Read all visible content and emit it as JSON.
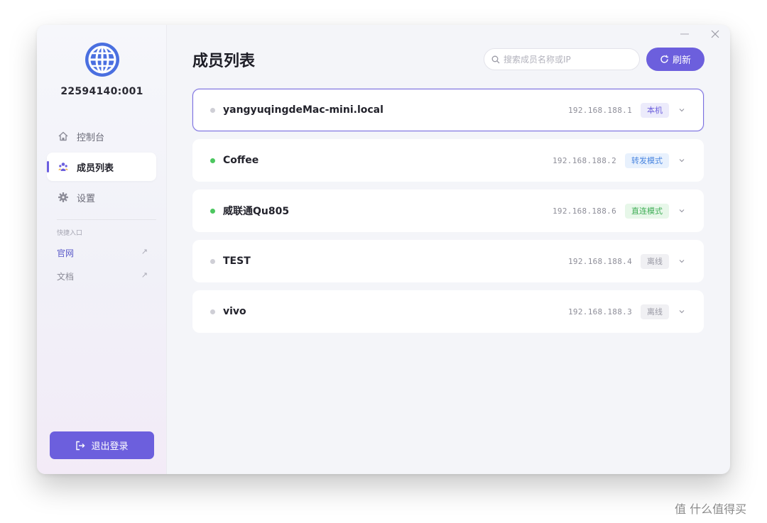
{
  "sidebar": {
    "node_id": "22594140:001",
    "nav": [
      {
        "label": "控制台",
        "icon": "home-icon"
      },
      {
        "label": "成员列表",
        "icon": "users-icon"
      },
      {
        "label": "设置",
        "icon": "gear-icon"
      }
    ],
    "quick_title": "快捷入口",
    "quick_links": [
      {
        "label": "官网",
        "arrow": "↗"
      },
      {
        "label": "文档",
        "arrow": "↗"
      }
    ],
    "logout_label": "退出登录"
  },
  "main": {
    "title": "成员列表",
    "search_placeholder": "搜索成员名称或IP",
    "refresh_label": "刷新",
    "members": [
      {
        "name": "yangyuqingdeMac-mini.local",
        "ip": "192.168.188.1",
        "badge": "本机"
      },
      {
        "name": "Coffee",
        "ip": "192.168.188.2",
        "badge": "转发模式"
      },
      {
        "name": "威联通Qu805",
        "ip": "192.168.188.6",
        "badge": "直连模式"
      },
      {
        "name": "TEST",
        "ip": "192.168.188.4",
        "badge": "离线"
      },
      {
        "name": "vivo",
        "ip": "192.168.188.3",
        "badge": "离线"
      }
    ]
  },
  "colors": {
    "accent": "#6c5fdd",
    "online": "#4cc760",
    "offline": "#cfcfd6",
    "badge_local_bg": "#ecebfb",
    "badge_local_fg": "#6c5fdd",
    "badge_relay_bg": "#e8f1fd",
    "badge_relay_fg": "#4a86e0",
    "badge_direct_bg": "#e7f7e9",
    "badge_direct_fg": "#3fae56",
    "badge_offline_bg": "#f0f0f3",
    "badge_offline_fg": "#9a9aa5"
  },
  "watermark": "值 什么值得买"
}
